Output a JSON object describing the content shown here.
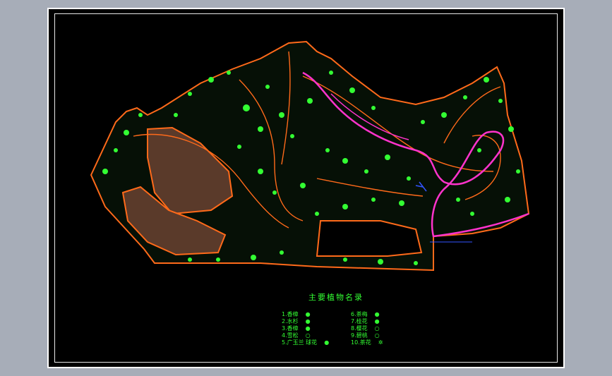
{
  "legend": {
    "title": "主要植物名录",
    "items": [
      {
        "label": "1.香樟",
        "symbol": "●"
      },
      {
        "label": "2.水杉",
        "symbol": "●"
      },
      {
        "label": "3.香樟",
        "symbol": "●"
      },
      {
        "label": "4.雪松",
        "symbol": "○"
      },
      {
        "label": "5.广玉兰 球花",
        "symbol": "●"
      },
      {
        "label": "6.茶梅",
        "symbol": "●"
      },
      {
        "label": "7.桂花",
        "symbol": "●"
      },
      {
        "label": "8.樱花",
        "symbol": "○"
      },
      {
        "label": "9.碧桃",
        "symbol": "○"
      },
      {
        "label": "10.茶花",
        "symbol": "✲"
      }
    ]
  },
  "colors": {
    "background": "#a7adb8",
    "sheet": "#000000",
    "contour": "#ff6a1a",
    "vegetation": "#33ff33",
    "path": "#ff33cc",
    "water_outline": "#3355ff"
  }
}
